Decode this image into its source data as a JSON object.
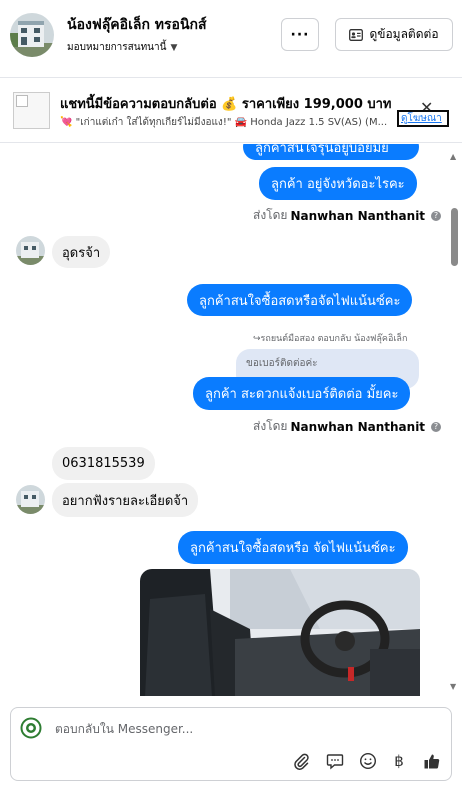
{
  "header": {
    "contact_name": "น้องฟลุ๊คอิเล็ก ทรอนิกส์",
    "assignee": "มอบหมายการสนทนานี้",
    "more_label": "···",
    "info_button": "ดูข้อมูลติดต่อ"
  },
  "banner": {
    "title": "แชทนี้มีข้อความตอบกลับต่อ 💰 ราคาเพียง 199,000 บาท",
    "subtitle": "💘 \"เก่าแต่เก๋า ใส่ได้ทุกเกียร์ไม่มีงอแง!\" 🚘 Honda Jazz 1.5 SV(AS) (M...",
    "link": "ดูโฆษณา",
    "close": "✕"
  },
  "messages": {
    "out_partial": "ลูกค้าสนใจรุ่นอยู่บ่อยมั้ย",
    "out_1": "ลูกค้า อยู่จังหวัดอะไรคะ",
    "sent_by_prefix": "ส่งโดย",
    "sent_by_name": "Nanwhan Nanthanit",
    "in_1": "อุดรจ้า",
    "out_2": "ลูกค้าสนใจซื้อสดหรือจัดไฟแน้นซ์คะ",
    "reply_note": "รถยนต์มือสอง ตอบกลับ น้องฟลุ๊คอิเล็ก",
    "quote": "ขอเบอร์ติดต่อค่ะ",
    "out_3": "ลูกค้า  สะดวกแจ้งเบอร์ติดต่อ มั้ยคะ",
    "sent_by_name_2": "Nanwhan Nanthanit",
    "in_2": "0631815539",
    "in_3": "อยากฟังรายละเอียดจ้า",
    "out_4": "ลูกค้าสนใจซื้อสดหรือ จัดไฟแน้นซ์คะ"
  },
  "composer": {
    "placeholder": "ตอบกลับใน Messenger..."
  },
  "colors": {
    "outgoing_bubble": "#0a7cff",
    "incoming_bubble": "#f0f0f0",
    "quote_bubble": "#dfe7f5"
  },
  "icons": [
    "attachment-icon",
    "comment-icon",
    "emoji-icon",
    "baht-icon",
    "thumbs-up-icon"
  ]
}
